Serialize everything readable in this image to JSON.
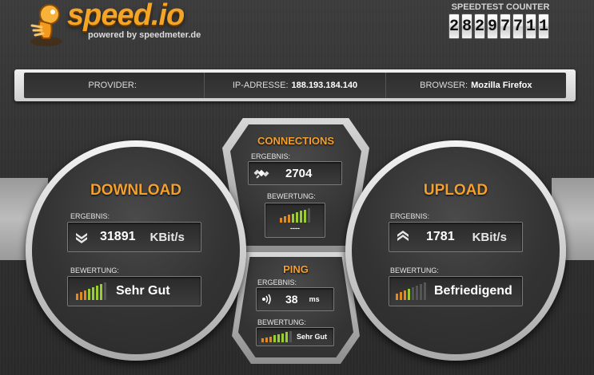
{
  "header": {
    "logo_text": "speed.io",
    "tagline": "powered by speedmeter.de",
    "counter": {
      "label": "SPEEDTEST COUNTER",
      "digits": [
        "2",
        "8",
        "2",
        "9",
        "7",
        "7",
        "1",
        "1"
      ]
    }
  },
  "info_bar": {
    "provider_label": "PROVIDER:",
    "provider_value": "",
    "ip_label": "IP-ADRESSE:",
    "ip_value": "188.193.184.140",
    "browser_label": "BROWSER:",
    "browser_value": "Mozilla Firefox"
  },
  "download": {
    "title": "DOWNLOAD",
    "result_label": "ERGEBNIS:",
    "value": "31891",
    "unit": "KBit/s",
    "rating_label": "BEWERTUNG:",
    "rating": "Sehr Gut",
    "rating_level": 7,
    "icon": "double-chevron-down-icon"
  },
  "upload": {
    "title": "UPLOAD",
    "result_label": "ERGEBNIS:",
    "value": "1781",
    "unit": "KBit/s",
    "rating_label": "BEWERTUNG:",
    "rating": "Befriedigend",
    "rating_level": 4,
    "icon": "double-chevron-up-icon"
  },
  "connections": {
    "title": "CONNECTIONS",
    "result_label": "ERGEBNIS:",
    "value": "2704",
    "rating_label": "BEWERTUNG:",
    "rating": "----",
    "rating_level": 7,
    "icon": "satellite-icon"
  },
  "ping": {
    "title": "PING",
    "result_label": "ERGEBNIS:",
    "value": "38",
    "unit": "ms",
    "rating_label": "BEWERTUNG:",
    "rating": "Sehr Gut",
    "rating_level": 7,
    "icon": "signal-waves-icon"
  },
  "colors": {
    "accent": "#f5a02a",
    "bar_active": "#9acd32",
    "bar_low": "#e08a20",
    "bar_off": "#555555"
  }
}
